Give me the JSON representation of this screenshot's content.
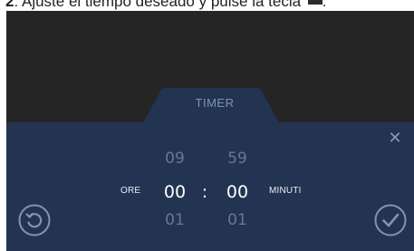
{
  "caption": {
    "step": "2",
    "text": ": Ajuste el tiempo deseado y pulse la tecla",
    "end": "."
  },
  "timer": {
    "tab_label": "TIMER",
    "hours": {
      "label": "ORE",
      "above": "09",
      "value": "00",
      "below": "01"
    },
    "separator": ":",
    "minutes": {
      "label": "MINUTI",
      "above": "59",
      "value": "00",
      "below": "01"
    }
  },
  "icons": {
    "close": "close-icon",
    "reset": "reset-icon",
    "confirm": "checkmark-icon"
  },
  "colors": {
    "screen_bg": "#252525",
    "panel_bg": "#223452",
    "dim_text": "#657895",
    "selected_text": "#ffffff"
  }
}
